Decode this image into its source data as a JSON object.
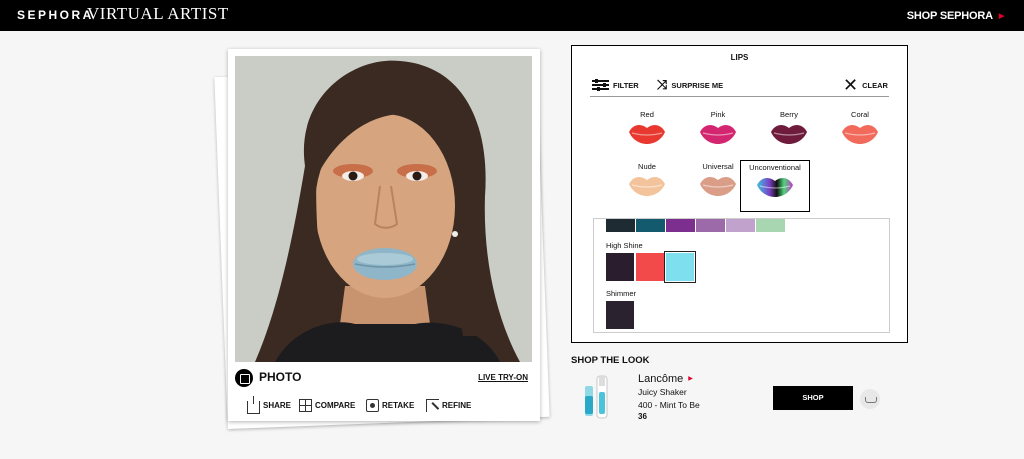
{
  "header": {
    "brand": "SEPHORA",
    "brand_sub": "VIRTUAL ARTIST",
    "shop_link": "SHOP SEPHORA"
  },
  "photo_card": {
    "mode_label": "PHOTO",
    "live_tryon_label": "LIVE TRY-ON",
    "actions": [
      {
        "label": "SHARE",
        "icon": "share-icon"
      },
      {
        "label": "COMPARE",
        "icon": "compare-icon"
      },
      {
        "label": "RETAKE",
        "icon": "camera-icon"
      },
      {
        "label": "REFINE",
        "icon": "refine-icon"
      }
    ]
  },
  "panel": {
    "title": "LIPS",
    "filter_label": "FILTER",
    "surprise_label": "SURPRISE ME",
    "clear_label": "CLEAR",
    "categories": [
      {
        "label": "Red",
        "color": "#e8382f"
      },
      {
        "label": "Pink",
        "color": "#d42670"
      },
      {
        "label": "Berry",
        "color": "#6e1b3c"
      },
      {
        "label": "Coral",
        "color": "#f26a5c"
      },
      {
        "label": "Nude",
        "color": "#f3c49c"
      },
      {
        "label": "Universal",
        "color": "#d99d88"
      },
      {
        "label": "Unconventional",
        "color": "#7a3fc4",
        "selected": true
      }
    ],
    "top_swatches": [
      "#1f2b33",
      "#145a6e",
      "#7c2f8f",
      "#9c6aa8",
      "#c0a2cc",
      "#a8d6b0"
    ],
    "sections": [
      {
        "label": "High Shine",
        "swatches": [
          "#2a1e2e",
          "#f24a4a",
          "#7ee0ef"
        ]
      },
      {
        "label": "Shimmer",
        "swatches": [
          "#2b2230"
        ]
      }
    ]
  },
  "shop_the_look": {
    "title": "SHOP THE LOOK",
    "brand": "Lancôme",
    "product": "Juicy Shaker",
    "shade": "400 - Mint To Be",
    "price": "36",
    "shop_button": "SHOP"
  }
}
